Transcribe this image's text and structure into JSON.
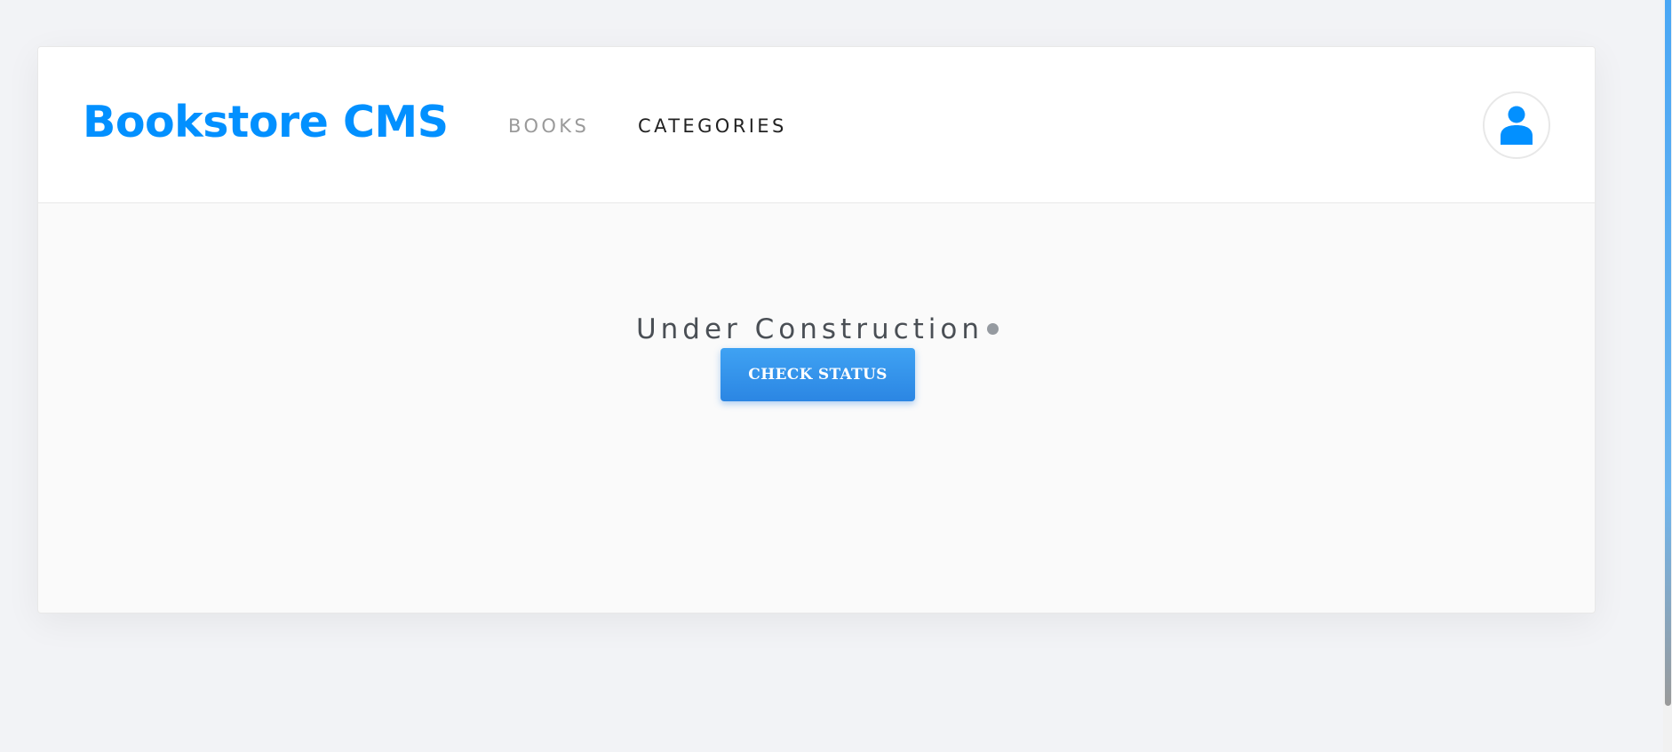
{
  "header": {
    "logo": "Bookstore CMS",
    "nav": {
      "books": "BOOKS",
      "categories": "CATEGORIES"
    },
    "avatar_icon": "user-icon"
  },
  "main": {
    "status_title": "Under Construction",
    "check_status_label": "CHECK STATUS"
  },
  "colors": {
    "brand": "#0290ff",
    "button": "#2b86e3",
    "nav_inactive": "#9a9a9a",
    "nav_active": "#222222"
  }
}
